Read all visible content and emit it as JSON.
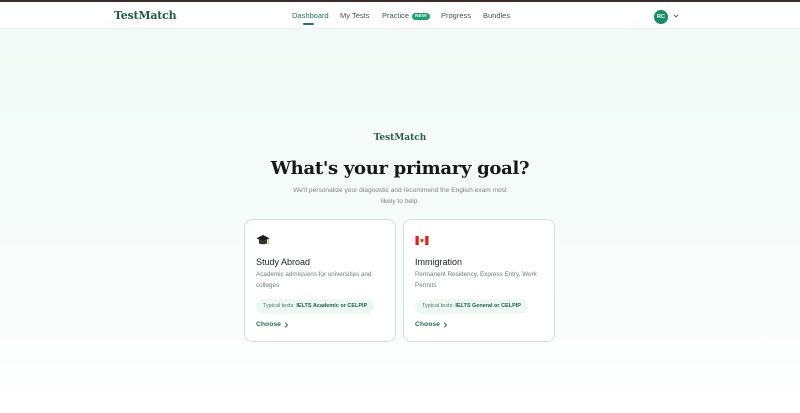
{
  "nav": {
    "brand": "TestMatch",
    "links": [
      {
        "label": "Dashboard",
        "active": true
      },
      {
        "label": "My Tests",
        "active": false
      },
      {
        "label": "Practice",
        "active": false,
        "badge": "NEW"
      },
      {
        "label": "Progress",
        "active": false
      },
      {
        "label": "Bundles",
        "active": false
      }
    ],
    "avatar_initials": "RC",
    "account_icon": "chevron-down-icon"
  },
  "main": {
    "logo": "TestMatch",
    "title": "What's your primary goal?",
    "subtitle": "We'll personalize your diagnostic and recommend the English exam most likely to help."
  },
  "cards": [
    {
      "icon": "graduation-cap-icon",
      "title": "Study Abroad",
      "description": "Academic admissions for universities and colleges",
      "tag_prefix": "Typical tests:",
      "tag_value": "IELTS Academic or CELPIP",
      "cta": "Choose"
    },
    {
      "icon": "canada-flag-icon",
      "title": "Immigration",
      "description": "Permanent Residency, Express Entry, Work Permits",
      "tag_prefix": "Typical tests:",
      "tag_value": "IELTS General or CELPIP",
      "cta": "Choose"
    }
  ],
  "colors": {
    "accent": "#1e7a56",
    "brand_dark": "#1f5e43",
    "tag_bg": "#eef8f3"
  }
}
